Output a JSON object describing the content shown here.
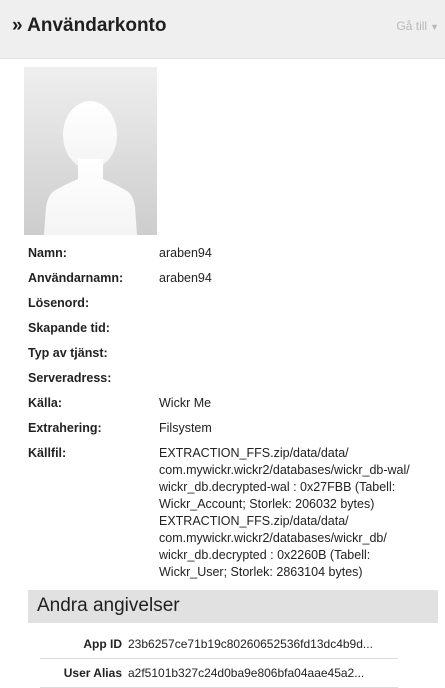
{
  "header": {
    "title": "» Användarkonto",
    "goto_label": "Gå till",
    "goto_icon": "caret-down-icon"
  },
  "avatar": {
    "icon": "default-user-silhouette"
  },
  "fields": [
    {
      "label": "Namn:",
      "value": "araben94"
    },
    {
      "label": "Användarnamn:",
      "value": "araben94"
    },
    {
      "label": "Lösenord:",
      "value": ""
    },
    {
      "label": "Skapande tid:",
      "value": ""
    },
    {
      "label": "Typ av tjänst:",
      "value": ""
    },
    {
      "label": "Serveradress:",
      "value": ""
    },
    {
      "label": "Källa:",
      "value": "Wickr Me"
    },
    {
      "label": "Extrahering:",
      "value": "Filsystem"
    }
  ],
  "source_file": {
    "label": "Källfil:",
    "lines": [
      "EXTRACTION_FFS.zip/data/data/",
      "com.mywickr.wickr2/databases/wickr_db-wal/",
      "wickr_db.decrypted-wal : 0x27FBB (Tabell:",
      "Wickr_Account; Storlek: 206032 bytes)",
      "EXTRACTION_FFS.zip/data/data/",
      "com.mywickr.wickr2/databases/wickr_db/",
      "wickr_db.decrypted : 0x2260B (Tabell:",
      "Wickr_User; Storlek: 2863104 bytes)"
    ]
  },
  "other": {
    "title": "Andra angivelser",
    "rows": [
      {
        "label": "App ID",
        "value": "23b6257ce71b19c80260652536fd13dc4b9d..."
      },
      {
        "label": "User Alias",
        "value": "a2f5101b327c24d0ba9e806bfa04aae45a2..."
      }
    ]
  }
}
